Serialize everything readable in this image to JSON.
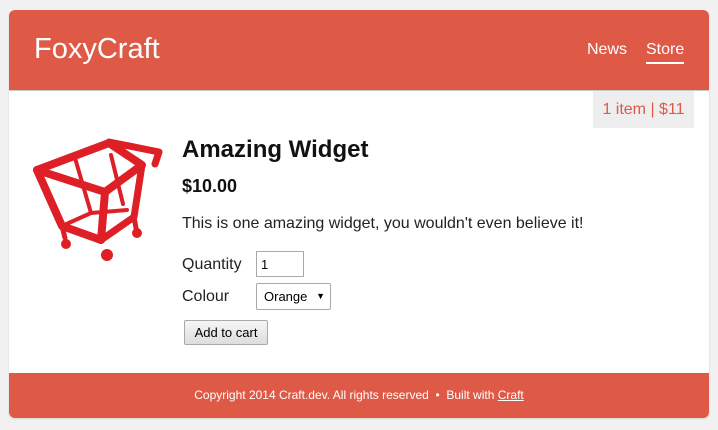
{
  "site": {
    "name": "FoxyCraft",
    "brand_color": "#de5a47"
  },
  "nav": {
    "items": [
      {
        "label": "News",
        "active": false
      },
      {
        "label": "Store",
        "active": true
      }
    ]
  },
  "cart": {
    "summary": "1 item | $11"
  },
  "product": {
    "image_icon": "shopping-cart-icon",
    "title": "Amazing Widget",
    "price": "$10.00",
    "description": "This is one amazing widget, you wouldn't even believe it!",
    "quantity_label": "Quantity",
    "quantity_value": "1",
    "colour_label": "Colour",
    "colour_selected": "Orange",
    "add_to_cart_label": "Add to cart"
  },
  "footer": {
    "copyright": "Copyright 2014 Craft.dev. All rights reserved",
    "separator": "•",
    "built_with": "Built with",
    "built_with_link": "Craft"
  }
}
